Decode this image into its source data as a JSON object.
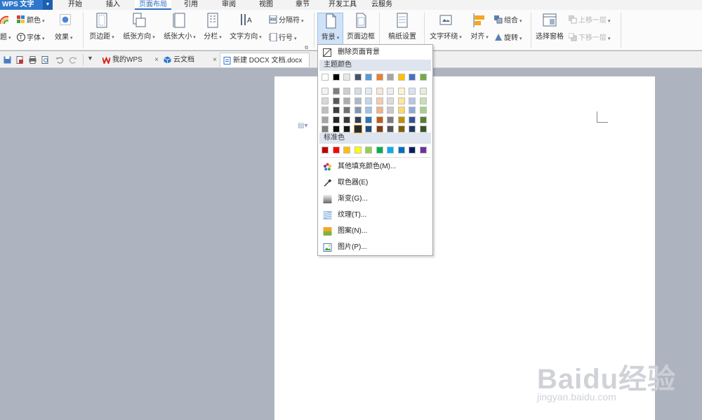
{
  "app": {
    "name": "WPS 文字"
  },
  "menu_tabs": [
    "开始",
    "插入",
    "页面布局",
    "引用",
    "审阅",
    "视图",
    "章节",
    "开发工具",
    "云服务"
  ],
  "active_tab": "页面布局",
  "ribbon": {
    "theme_label": "题",
    "colors_label": "颜色",
    "fonts_label": "字体",
    "effects_label": "效果",
    "margins": "页边距",
    "orientation": "纸张方向",
    "size": "纸张大小",
    "columns": "分栏",
    "text_direction": "文字方向",
    "separator": "分隔符",
    "line_number": "行号",
    "background": "背景",
    "page_border": "页面边框",
    "draft_settings": "稿纸设置",
    "text_wrap": "文字环绕",
    "align": "对齐",
    "group": "组合",
    "rotate": "旋转",
    "selection_pane": "选择窗格",
    "bring_forward": "上移一层",
    "send_backward": "下移一层"
  },
  "tabs": [
    {
      "label": "我的WPS",
      "close": "×"
    },
    {
      "label": "云文档",
      "close": "×"
    },
    {
      "label": "新建 DOCX 文档.docx",
      "close": ""
    }
  ],
  "bg_menu": {
    "remove": "删除页面背景",
    "theme_colors_title": "主题颜色",
    "standard_colors_title": "标准色",
    "theme_top_row": [
      "#ffffff",
      "#000000",
      "#e7e6e6",
      "#44546a",
      "#5b9bd5",
      "#ed7d31",
      "#a5a5a5",
      "#ffc000",
      "#4472c4",
      "#70ad47"
    ],
    "theme_shades": [
      [
        "#f2f2f2",
        "#7f7f7f",
        "#d0cece",
        "#d6dce4",
        "#deebf6",
        "#fbe5d5",
        "#ededed",
        "#fff2cc",
        "#dae3f3",
        "#e2efd9"
      ],
      [
        "#d8d8d8",
        "#595959",
        "#aeabab",
        "#adb9ca",
        "#bdd7ee",
        "#f8cbad",
        "#dbdbdb",
        "#fee599",
        "#b4c6e7",
        "#c5e0b3"
      ],
      [
        "#bfbfbf",
        "#3f3f3f",
        "#757070",
        "#8496b0",
        "#9dc3e6",
        "#f4b183",
        "#c9c9c9",
        "#ffd965",
        "#8eaadb",
        "#a8d08d"
      ],
      [
        "#a5a5a5",
        "#262626",
        "#3a3838",
        "#323f4f",
        "#2e75b5",
        "#c55a11",
        "#7b7b7b",
        "#bf9000",
        "#2f5496",
        "#538135"
      ],
      [
        "#7f7f7f",
        "#0c0c0c",
        "#171616",
        "#222a35",
        "#1e4e79",
        "#833c0b",
        "#525252",
        "#7f6000",
        "#1f3864",
        "#375623"
      ]
    ],
    "standard": [
      "#c00000",
      "#ff0000",
      "#ffc000",
      "#ffff00",
      "#92d050",
      "#00b050",
      "#00b0f0",
      "#0070c0",
      "#002060",
      "#7030a0"
    ],
    "items": [
      "其他填充颜色(M)...",
      "取色器(E)",
      "渐变(G)...",
      "纹理(T)...",
      "图案(N)...",
      "图片(P)..."
    ]
  },
  "watermark": {
    "main": "Baidu经验",
    "sub": "jingyan.baidu.com"
  }
}
